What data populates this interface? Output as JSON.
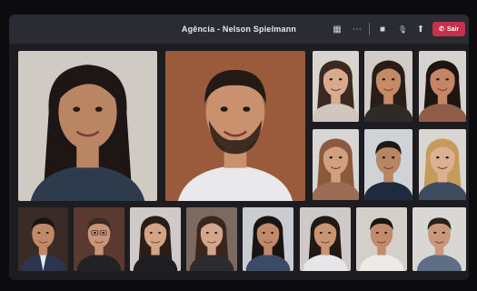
{
  "meeting": {
    "title": "Agência - Nelson Spielmann",
    "leave_label": "Sair"
  },
  "controls": [
    {
      "name": "layout-icon",
      "glyph": "▦"
    },
    {
      "name": "more-options-icon",
      "glyph": "⋯"
    },
    {
      "name": "camera-icon",
      "glyph": "■"
    },
    {
      "name": "microphone-icon",
      "glyph": "🎙"
    },
    {
      "name": "share-screen-icon",
      "glyph": "⬆"
    }
  ],
  "colors": {
    "window_bg": "#1c1c21",
    "titlebar_bg": "#2b2b33",
    "leave_button": "#c4314b"
  },
  "participants": [
    {
      "role": "speaker",
      "bg": "#cfcac4",
      "skin": "#b98563",
      "hair": "#1d1614",
      "shirt": "#2e3b4d",
      "hair_style": "long"
    },
    {
      "role": "speaker",
      "bg": "#9a5a3c",
      "skin": "#c9916d",
      "hair": "#241a15",
      "shirt": "#e9e9ec",
      "hair_style": "short",
      "beard": true
    },
    {
      "role": "grid",
      "bg": "#d8d4d0",
      "skin": "#d9ab8d",
      "hair": "#3a2a22",
      "shirt": "#cfc6bd",
      "hair_style": "long"
    },
    {
      "role": "grid",
      "bg": "#d1ccc7",
      "skin": "#c68a66",
      "hair": "#2a1d17",
      "shirt": "#2e2a28",
      "hair_style": "long"
    },
    {
      "role": "grid",
      "bg": "#d6d2cf",
      "skin": "#c58665",
      "hair": "#1c1512",
      "shirt": "#8d5d48",
      "hair_style": "long"
    },
    {
      "role": "grid",
      "bg": "#d8d6d4",
      "skin": "#d2a07e",
      "hair": "#8b5a3c",
      "shirt": "#9a6c53",
      "hair_style": "long"
    },
    {
      "role": "grid",
      "bg": "#cfd2d6",
      "skin": "#b98663",
      "hair": "#1f1915",
      "shirt": "#1e2a3d",
      "hair_style": "short"
    },
    {
      "role": "grid",
      "bg": "#d9d6d2",
      "skin": "#dcb192",
      "hair": "#c59a5a",
      "shirt": "#3e4a5e",
      "hair_style": "long"
    },
    {
      "role": "grid",
      "bg": "#3b2b26",
      "skin": "#c08a68",
      "hair": "#1a1412",
      "shirt": "#2b3550",
      "hair_style": "short",
      "suit": true
    },
    {
      "role": "grid",
      "bg": "#5a3a30",
      "skin": "#c89578",
      "hair": "#3a2b22",
      "shirt": "#222226",
      "hair_style": "short",
      "glasses": true
    },
    {
      "role": "grid",
      "bg": "#cfcac7",
      "skin": "#d3a585",
      "hair": "#2a1d18",
      "shirt": "#1e1e22",
      "hair_style": "long"
    },
    {
      "role": "grid",
      "bg": "#7c6a60",
      "skin": "#d3a58a",
      "hair": "#3a261c",
      "shirt": "#2b2b30",
      "hair_style": "long"
    },
    {
      "role": "grid",
      "bg": "#c9cdd1",
      "skin": "#c08a6a",
      "hair": "#1a1411",
      "shirt": "#3b4a66",
      "hair_style": "long"
    },
    {
      "role": "grid",
      "bg": "#cdcac7",
      "skin": "#c99472",
      "hair": "#221914",
      "shirt": "#e6e6ea",
      "hair_style": "long"
    },
    {
      "role": "grid",
      "bg": "#d3d0cc",
      "skin": "#c08b6b",
      "hair": "#1c1613",
      "shirt": "#ecebe8",
      "hair_style": "short"
    },
    {
      "role": "grid",
      "bg": "#d8d7d4",
      "skin": "#c9977a",
      "hair": "#2b211b",
      "shirt": "#5f6e86",
      "hair_style": "short"
    }
  ]
}
